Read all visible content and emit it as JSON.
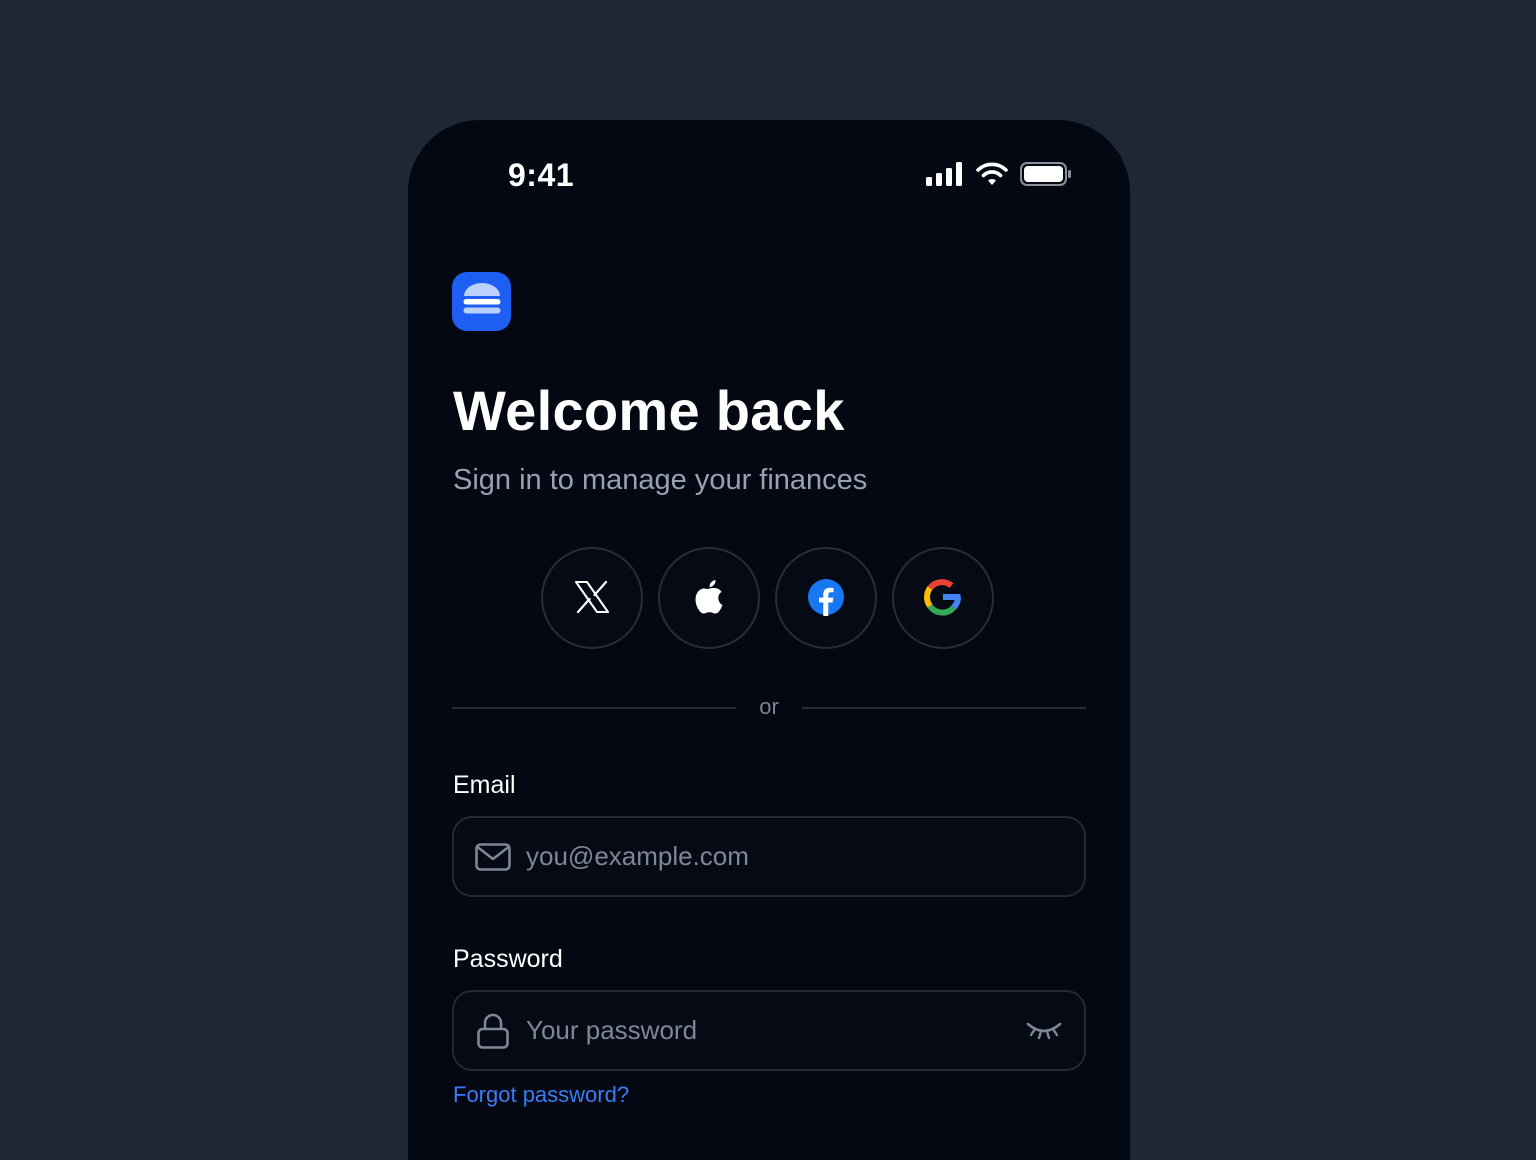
{
  "status_bar": {
    "time": "9:41",
    "icons": [
      "cellular-signal-icon",
      "wifi-icon",
      "battery-icon"
    ]
  },
  "app": {
    "logo_icon": "stacked-layers-icon",
    "accent_color": "#1d5ff2"
  },
  "header": {
    "title": "Welcome back",
    "subtitle": "Sign in to manage your finances"
  },
  "social_login": {
    "buttons": [
      {
        "provider": "X",
        "icon": "x-logo-icon"
      },
      {
        "provider": "Apple",
        "icon": "apple-logo-icon"
      },
      {
        "provider": "Facebook",
        "icon": "facebook-logo-icon"
      },
      {
        "provider": "Google",
        "icon": "google-logo-icon"
      }
    ]
  },
  "divider": {
    "label": "or"
  },
  "form": {
    "email": {
      "label": "Email",
      "placeholder": "you@example.com",
      "value": "",
      "icon": "mail-icon"
    },
    "password": {
      "label": "Password",
      "placeholder": "Your password",
      "value": "",
      "icon": "lock-icon",
      "toggle_icon": "eye-closed-icon"
    },
    "forgot_link": "Forgot password?",
    "link_color": "#3b7cf6"
  }
}
